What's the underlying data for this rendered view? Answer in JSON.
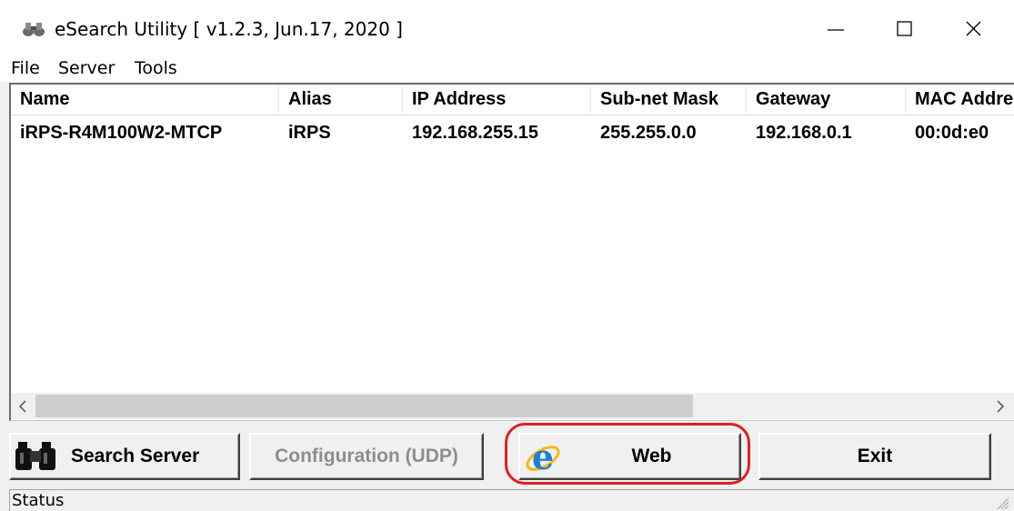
{
  "window": {
    "title": "eSearch Utility [ v1.2.3, Jun.17, 2020 ]",
    "icon": "binoculars-icon"
  },
  "menu": [
    "File",
    "Server",
    "Tools"
  ],
  "table": {
    "columns": [
      "Name",
      "Alias",
      "IP Address",
      "Sub-net Mask",
      "Gateway",
      "MAC Address"
    ],
    "rows": [
      [
        "iRPS-R4M100W2-MTCP",
        "iRPS",
        "192.168.255.15",
        "255.255.0.0",
        "192.168.0.1",
        "00:0d:e0"
      ]
    ]
  },
  "buttons": {
    "search_server": "Search Server",
    "configuration": "Configuration (UDP)",
    "web": "Web",
    "exit": "Exit"
  },
  "status": "Status",
  "colors": {
    "highlight": "#e02020",
    "ie_blue": "#1e7fd8",
    "ie_ring": "#f2b90f"
  }
}
